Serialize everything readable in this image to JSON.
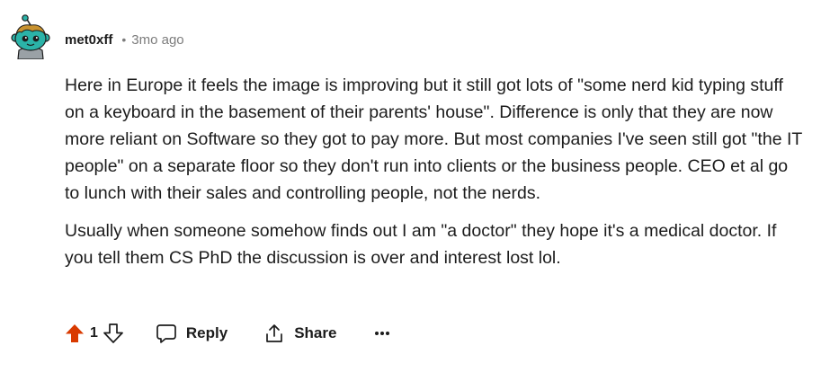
{
  "comment": {
    "avatar_icon": "snoo-avatar-icon",
    "username": "met0xff",
    "separator": "•",
    "timestamp": "3mo ago",
    "paragraphs": [
      "Here in Europe it feels the image is improving but it still got lots of \"some nerd kid typing stuff on a keyboard in the basement of their parents' house\". Difference is only that they are now more reliant on Software so they got to pay more. But most companies I've seen still got \"the IT people\" on a separate floor so they don't run into clients or the business people. CEO et al go to lunch with their sales and controlling people, not the nerds.",
      "Usually when someone somehow finds out I am \"a doctor\" they hope it's a medical doctor. If you tell them CS PhD the discussion is over and interest lost lol."
    ]
  },
  "actions": {
    "upvote_icon": "upvote-arrow-icon",
    "upvote_active_color": "#d93a00",
    "score": "1",
    "downvote_icon": "downvote-arrow-icon",
    "reply_label": "Reply",
    "reply_icon": "speech-bubble-icon",
    "share_label": "Share",
    "share_icon": "share-icon",
    "more_icon": "ellipsis-icon"
  }
}
